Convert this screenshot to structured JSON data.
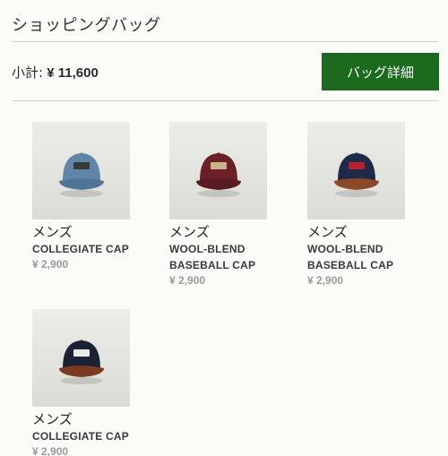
{
  "header": {
    "title": "ショッピングバッグ"
  },
  "summary": {
    "subtotal_label": "小計:",
    "subtotal_value": "¥ 11,600",
    "details_button": "バッグ詳細",
    "button_color": "#1b6a1d"
  },
  "products": [
    {
      "category": "メンズ",
      "name": "COLLEGIATE CAP",
      "price": "¥ 2,900",
      "cap_color": "#5f86a8",
      "patch_color": "#3a3a34",
      "brim_color": "#4f7496"
    },
    {
      "category": "メンズ",
      "name": "WOOL-BLEND\nBASEBALL CAP",
      "price": "¥ 2,900",
      "cap_color": "#6b1f27",
      "patch_color": "#c9b48a",
      "brim_color": "#5a1a21"
    },
    {
      "category": "メンズ",
      "name": "WOOL-BLEND\nBASEBALL CAP",
      "price": "¥ 2,900",
      "cap_color": "#1f2a48",
      "patch_color": "#b0232f",
      "brim_color": "#8a4a2a"
    },
    {
      "category": "メンズ",
      "name": "COLLEGIATE CAP",
      "price": "¥ 2,900",
      "cap_color": "#1b2233",
      "patch_color": "#e8e8e8",
      "brim_color": "#7a3b22"
    }
  ]
}
